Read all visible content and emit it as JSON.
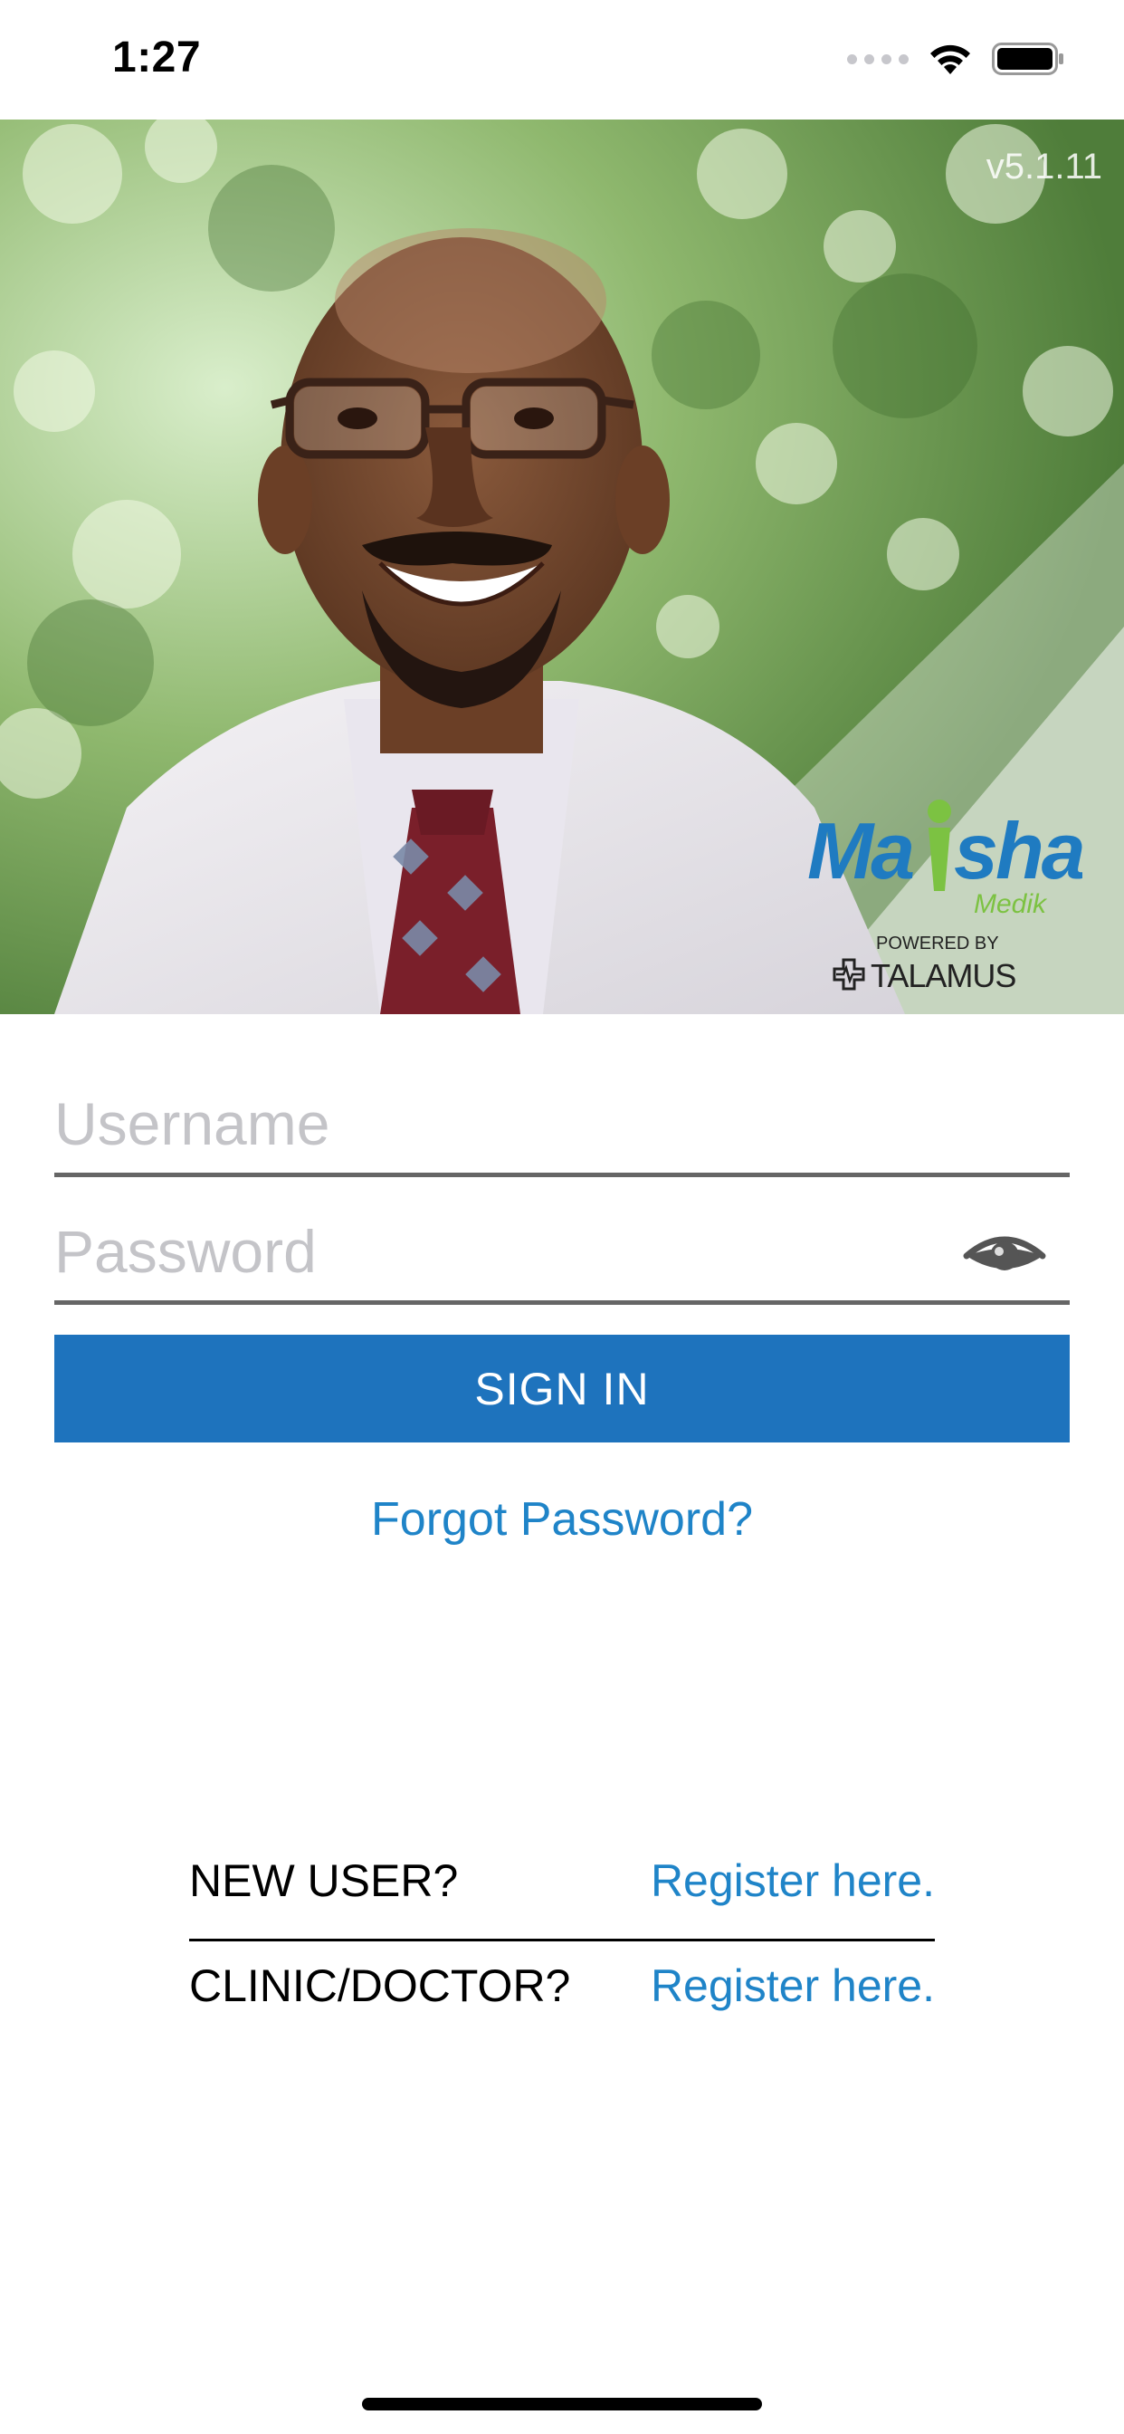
{
  "status_bar": {
    "time": "1:27"
  },
  "hero": {
    "version": "v5.1.11",
    "logo": {
      "brand": "Maisha",
      "sub": "Medik",
      "powered_by": "POWERED BY",
      "partner": "TALAMUS"
    }
  },
  "login_form": {
    "username_placeholder": "Username",
    "username_value": "",
    "password_placeholder": "Password",
    "password_value": "",
    "sign_in_label": "SIGN IN",
    "forgot_password_label": "Forgot Password?"
  },
  "register": {
    "new_user_label": "NEW USER?",
    "new_user_link": "Register here.",
    "clinic_label": "CLINIC/DOCTOR?",
    "clinic_link": "Register here."
  },
  "colors": {
    "primary": "#1e73bd",
    "link": "#1f84c8",
    "logo_blue": "#1f7bc1",
    "logo_green": "#7cc242"
  },
  "icons": {
    "status": [
      "signal-icon",
      "wifi-icon",
      "battery-icon"
    ],
    "password_toggle": "eye-icon"
  }
}
